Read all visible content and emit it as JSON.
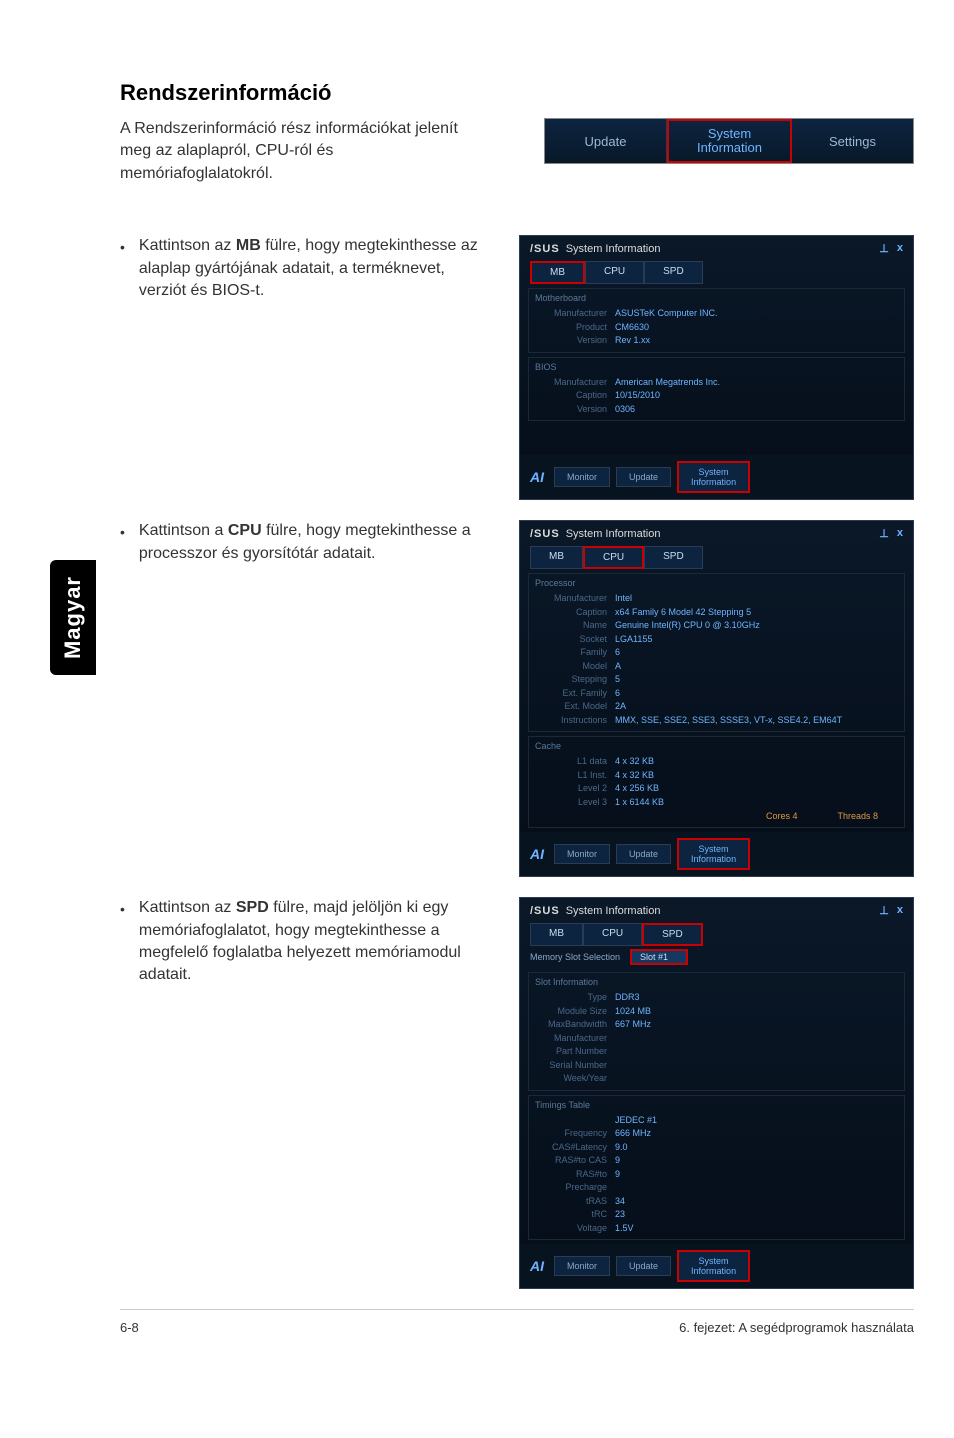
{
  "page": {
    "title": "Rendszerinformáció",
    "intro": "A Rendszerinformáció rész információkat jelenít meg az alaplapról, CPU-ról és memóriafoglalatokról.",
    "side_tab": "Magyar",
    "footer_left": "6-8",
    "footer_right": "6. fejezet: A segédprogramok használata"
  },
  "top_nav": {
    "update": "Update",
    "sysinfo": "System\nInformation",
    "settings": "Settings"
  },
  "bullets": {
    "mb": {
      "pre": "Kattintson az ",
      "bold": "MB",
      "post": " fülre, hogy megtekinthesse az alaplap gyártójának adatait, a terméknevet, verziót és BIOS-t."
    },
    "cpu": {
      "pre": "Kattintson a ",
      "bold": "CPU",
      "post": " fülre, hogy megtekinthesse a processzor és gyorsítótár adatait."
    },
    "spd": {
      "pre": "Kattintson az ",
      "bold": "SPD",
      "post": " fülre, majd jelöljön ki egy memóriafoglalatot, hogy megtekinthesse a megfelelő foglalatba helyezett memóriamodul adatait."
    }
  },
  "panel_common": {
    "asus": "/SUS",
    "title": "System Information",
    "pin": "⊥",
    "close": "x",
    "footer_icon": "AI",
    "btn_monitor": "Monitor",
    "btn_update": "Update",
    "btn_sysinfo": "System\nInformation"
  },
  "tabs": {
    "mb": "MB",
    "cpu": "CPU",
    "spd": "SPD"
  },
  "mb_panel": {
    "section1": "Motherboard",
    "manufacturer_k": "Manufacturer",
    "manufacturer_v": "ASUSTeK Computer INC.",
    "product_k": "Product",
    "product_v": "CM6630",
    "version_k": "Version",
    "version_v": "Rev 1.xx",
    "section2": "BIOS",
    "bios_mfr_k": "Manufacturer",
    "bios_mfr_v": "American Megatrends Inc.",
    "caption_k": "Caption",
    "caption_v": "10/15/2010",
    "bios_ver_k": "Version",
    "bios_ver_v": "0306"
  },
  "cpu_panel": {
    "section1": "Processor",
    "mfr_k": "Manufacturer",
    "mfr_v": "Intel",
    "caption_k": "Caption",
    "caption_v": "x64 Family 6 Model 42 Stepping 5",
    "name_k": "Name",
    "name_v": "Genuine Intel(R) CPU 0 @ 3.10GHz",
    "socket_k": "Socket",
    "socket_v": "LGA1155",
    "family_k": "Family",
    "family_v": "6",
    "model_k": "Model",
    "model_v": "A",
    "stepping_k": "Stepping",
    "stepping_v": "5",
    "extfam_k": "Ext. Family",
    "extfam_v": "6",
    "extmod_k": "Ext. Model",
    "extmod_v": "2A",
    "instr_k": "Instructions",
    "instr_v": "MMX, SSE, SSE2, SSE3, SSSE3, VT-x, SSE4.2, EM64T",
    "section2": "Cache",
    "l1d_k": "L1 data",
    "l1d_v": "4 x 32 KB",
    "l1i_k": "L1 Inst.",
    "l1i_v": "4 x 32 KB",
    "l2_k": "Level 2",
    "l2_v": "4 x 256 KB",
    "l3_k": "Level 3",
    "l3_v": "1 x 6144 KB",
    "cores": "Cores  4",
    "threads": "Threads  8"
  },
  "spd_panel": {
    "slot_sel_label": "Memory Slot Selection",
    "slot_sel_value": "Slot #1",
    "section1": "Slot Information",
    "type_k": "Type",
    "type_v": "DDR3",
    "size_k": "Module Size",
    "size_v": "1024 MB",
    "bw_k": "MaxBandwidth",
    "bw_v": "667 MHz",
    "mfr_k": "Manufacturer",
    "mfr_v": "",
    "pn_k": "Part Number",
    "pn_v": "",
    "sn_k": "Serial Number",
    "sn_v": "",
    "wk_k": "Week/Year",
    "wk_v": "",
    "section2": "Timings Table",
    "tt_header": "JEDEC #1",
    "freq_k": "Frequency",
    "freq_v": "666 MHz",
    "cas_k": "CAS#Latency",
    "cas_v": "9.0",
    "rcd_k": "RAS#to CAS",
    "rcd_v": "9",
    "rp_k": "RAS#to Precharge",
    "rp_v": "9",
    "tras_k": "tRAS",
    "tras_v": "34",
    "trc_k": "tRC",
    "trc_v": "23",
    "volt_k": "Voltage",
    "volt_v": "1.5V"
  }
}
